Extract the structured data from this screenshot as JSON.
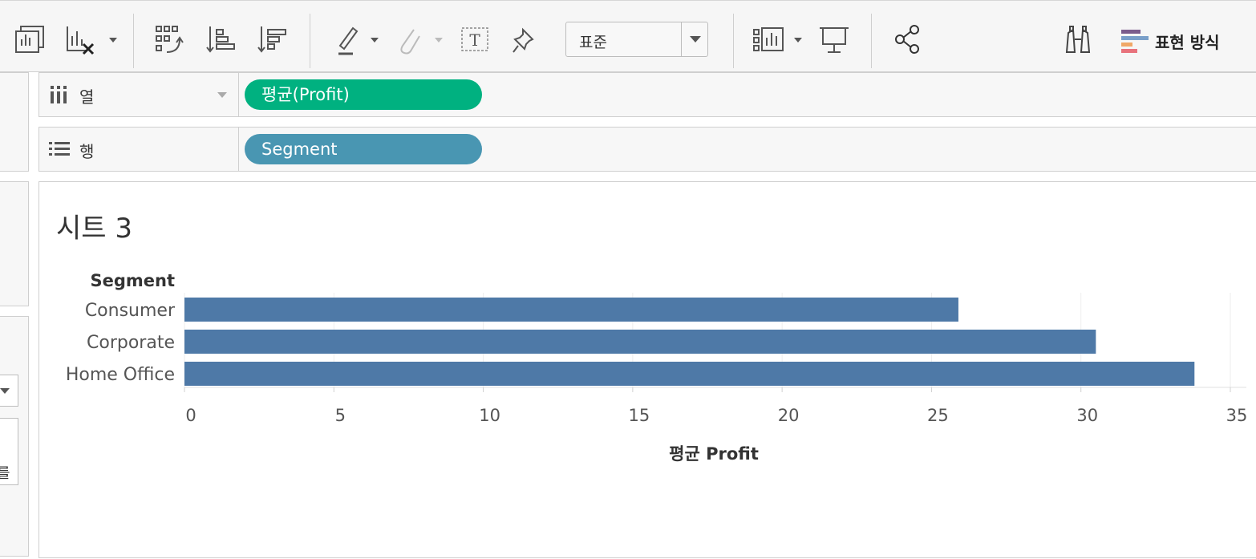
{
  "toolbar": {
    "icons": [
      "new-worksheet-icon",
      "clear-sheet-icon",
      "group-members-icon",
      "sort-ascending-icon",
      "sort-descending-icon",
      "highlight-icon",
      "attach-icon",
      "show-mark-labels-icon",
      "pin-axes-icon",
      "show-cards-icon",
      "presentation-mode-icon",
      "share-icon",
      "binoculars-icon",
      "show-me-icon"
    ],
    "fit_select_value": "표준",
    "show_me_label": "표현 방식"
  },
  "colors": {
    "columns_pill": "#00b180",
    "rows_pill": "#4996b2",
    "bar": "#4e79a7"
  },
  "shelves": {
    "columns": {
      "label": "열",
      "pill": "평균(Profit)"
    },
    "rows": {
      "label": "행",
      "pill": "Segment"
    }
  },
  "sheet": {
    "title": "시트 3"
  },
  "chart_data": {
    "type": "bar",
    "orientation": "horizontal",
    "row_header": "Segment",
    "categories": [
      "Consumer",
      "Corporate",
      "Home Office"
    ],
    "values": [
      25.9,
      30.5,
      33.8
    ],
    "xlabel": "평균 Profit",
    "xlim": [
      0,
      35
    ],
    "xticks": [
      0,
      5,
      10,
      15,
      20,
      25,
      30,
      35
    ],
    "grid": true
  },
  "left_panel": {
    "cut_text": "를"
  }
}
